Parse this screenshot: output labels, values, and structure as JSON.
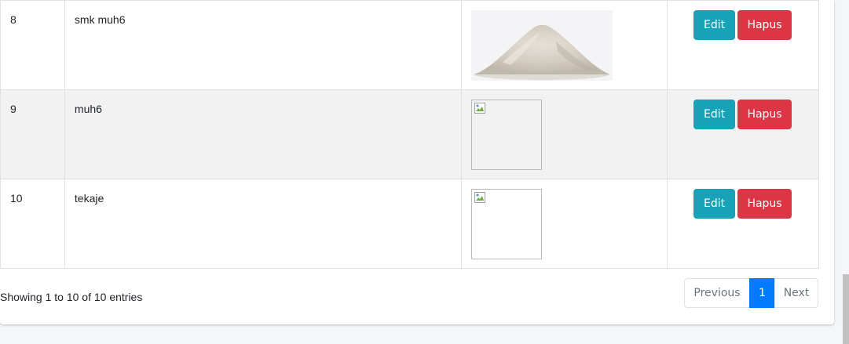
{
  "table": {
    "rows": [
      {
        "no": "8",
        "name": "smk muh6",
        "image": "rice",
        "striped": false
      },
      {
        "no": "9",
        "name": "muh6",
        "image": "broken",
        "striped": true
      },
      {
        "no": "10",
        "name": "tekaje",
        "image": "broken",
        "striped": false
      }
    ],
    "edit_label": "Edit",
    "delete_label": "Hapus"
  },
  "footer": {
    "info": "Showing 1 to 10 of 10 entries",
    "pagination": {
      "previous_label": "Previous",
      "current_page": "1",
      "next_label": "Next"
    }
  },
  "colors": {
    "edit": "#17a2b8",
    "delete": "#dc3545",
    "active_page": "#007bff"
  }
}
